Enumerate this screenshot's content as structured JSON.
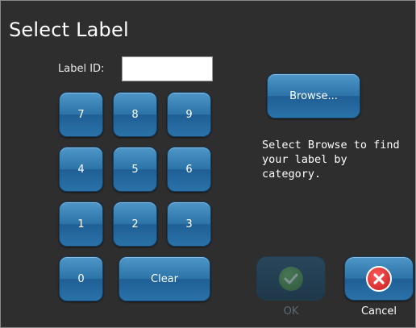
{
  "title": "Select Label",
  "label_id": {
    "label": "Label ID:",
    "value": "",
    "placeholder": ""
  },
  "keypad": {
    "keys": [
      "7",
      "8",
      "9",
      "4",
      "5",
      "6",
      "1",
      "2",
      "3",
      "0"
    ],
    "clear_label": "Clear"
  },
  "browse": {
    "button_label": "Browse...",
    "help_text": "Select Browse to find your label by category."
  },
  "actions": {
    "ok_label": "OK",
    "cancel_label": "Cancel",
    "ok_enabled": false
  },
  "colors": {
    "background": "#2e2e2e",
    "button_blue": "#2c73a8",
    "ok_icon": "#4f9a43",
    "cancel_icon": "#d92a2a"
  },
  "icons": {
    "ok": "checkmark-icon",
    "cancel": "x-icon"
  }
}
